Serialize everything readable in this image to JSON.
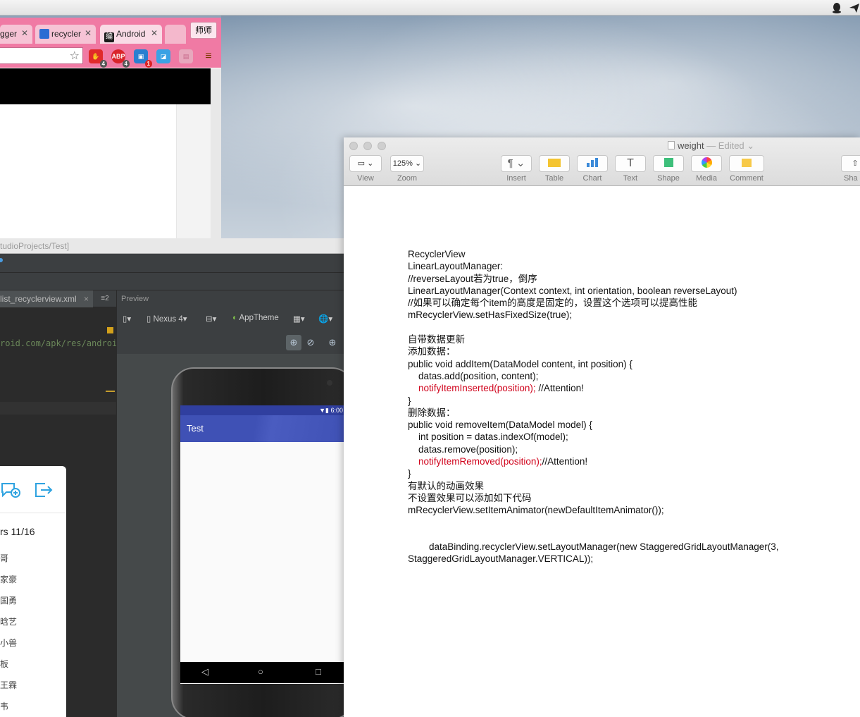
{
  "menubar": {
    "icons": [
      "qq-penguin-icon",
      "send-icon"
    ]
  },
  "browser": {
    "tabs": [
      {
        "label": "gger",
        "close": "✕"
      },
      {
        "label": "recycler",
        "close": "✕"
      },
      {
        "label": "Android",
        "close": "✕"
      }
    ],
    "profile_label": "师师",
    "extensions": [
      {
        "name": "adblock-icon",
        "badge": "4"
      },
      {
        "name": "abp-icon",
        "text": "ABP",
        "badge": "4"
      },
      {
        "name": "extension-icon",
        "badge": "1"
      }
    ]
  },
  "studio": {
    "title": "tudioProjects/Test]",
    "editor_tab": "list_recyclerview.xml",
    "tab_menu": "≡2",
    "code_line": "roid.com/apk/res/android",
    "preview_label": "Preview",
    "device": "Nexus 4",
    "theme": "AppTheme"
  },
  "phone": {
    "time": "6:00",
    "app_title": "Test"
  },
  "chat": {
    "group": "rs 11/16",
    "members": [
      "哥",
      "家豪",
      "国勇",
      "晗艺",
      "小兽",
      "板",
      "王霖",
      "韦"
    ]
  },
  "pages": {
    "title": "weight",
    "edited": " — Edited",
    "zoom": "125%",
    "toolbar": [
      {
        "label": "View"
      },
      {
        "label": "Zoom"
      },
      {
        "label": "Insert"
      },
      {
        "label": "Table"
      },
      {
        "label": "Chart"
      },
      {
        "label": "Text"
      },
      {
        "label": "Shape"
      },
      {
        "label": "Media"
      },
      {
        "label": "Comment"
      },
      {
        "label": "Sha"
      }
    ],
    "doc": [
      {
        "t": "RecyclerView"
      },
      {
        "t": "LinearLayoutManager:"
      },
      {
        "t": "//reverseLayout若为true，倒序"
      },
      {
        "t": "LinearLayoutManager(Context context, int orientation, boolean reverseLayout)"
      },
      {
        "t": "//如果可以确定每个item的高度是固定的，设置这个选项可以提高性能"
      },
      {
        "t": "mRecyclerView.setHasFixedSize(true);"
      },
      {
        "t": ""
      },
      {
        "t": "自带数据更新"
      },
      {
        "t": "添加数据："
      },
      {
        "t": "public void addItem(DataModel content, int position) {"
      },
      {
        "t": "    datas.add(position, content);"
      },
      {
        "red": "    notifyItemInserted(position);",
        "t": " //Attention!"
      },
      {
        "t": "}"
      },
      {
        "t": "删除数据："
      },
      {
        "t": "public void removeItem(DataModel model) {"
      },
      {
        "t": "    int position = datas.indexOf(model);"
      },
      {
        "t": "    datas.remove(position);"
      },
      {
        "red": "    notifyItemRemoved(position);",
        "t": "//Attention!"
      },
      {
        "t": "}"
      },
      {
        "t": "有默认的动画效果"
      },
      {
        "t": "不设置效果可以添加如下代码"
      },
      {
        "t": "mRecyclerView.setItemAnimator(newDefaultItemAnimator());"
      },
      {
        "t": ""
      },
      {
        "t": ""
      },
      {
        "t": "        dataBinding.recyclerView.setLayoutManager(new StaggeredGridLayoutManager(3,"
      },
      {
        "t": "StaggeredGridLayoutManager.VERTICAL));"
      }
    ]
  }
}
